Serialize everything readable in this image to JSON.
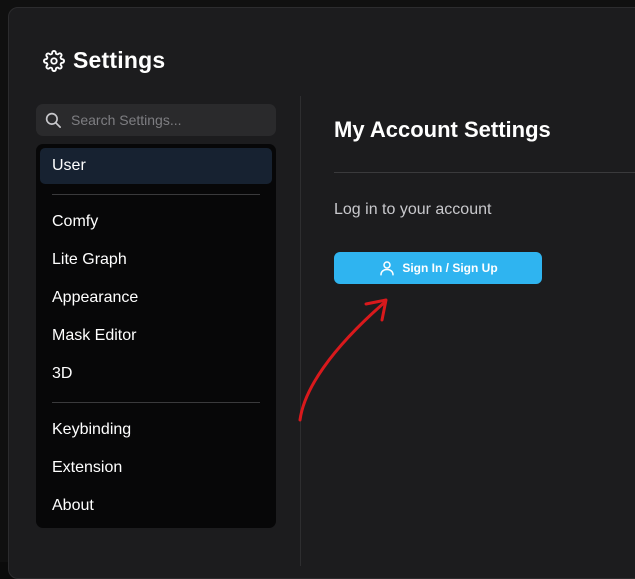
{
  "dialog": {
    "title": "Settings",
    "title_icon": "gear-icon"
  },
  "search": {
    "placeholder": "Search Settings...",
    "icon": "search-icon"
  },
  "sidebar": {
    "items": [
      {
        "label": "User",
        "active": true
      },
      {
        "label": "Comfy"
      },
      {
        "label": "Lite Graph"
      },
      {
        "label": "Appearance"
      },
      {
        "label": "Mask Editor"
      },
      {
        "label": "3D"
      },
      {
        "label": "Keybinding"
      },
      {
        "label": "Extension"
      },
      {
        "label": "About"
      }
    ]
  },
  "main": {
    "title": "My Account Settings",
    "login_prompt": "Log in to your account",
    "signin_label": "Sign In / Sign Up",
    "signin_icon": "user-icon"
  },
  "colors": {
    "accent": "#2fb4f0",
    "active_item": "#172231",
    "annotation_arrow": "#d9191c"
  }
}
